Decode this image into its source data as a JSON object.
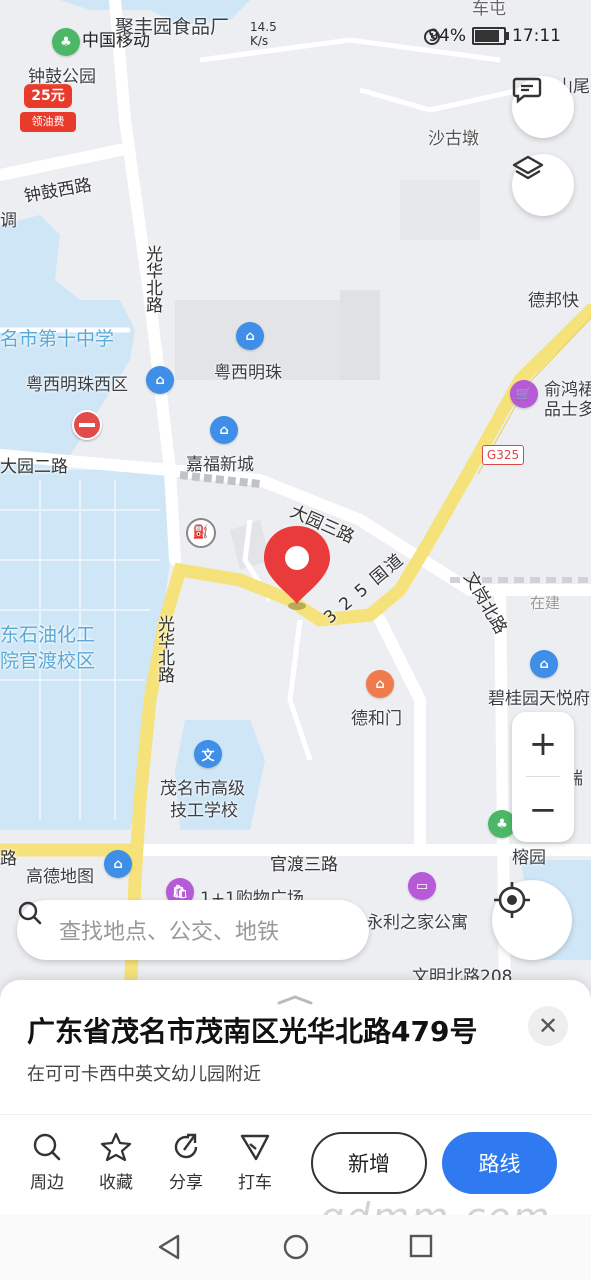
{
  "status_bar": {
    "carrier": "中国移动",
    "network_speed_value": "14.5",
    "network_speed_unit": "K/s",
    "battery_percent": "94%",
    "battery_level": 0.94,
    "time": "17:11"
  },
  "map": {
    "area_labels": {
      "food_factory": "聚丰园食品厂",
      "park": "钟鼓公园",
      "sha_gu_dun": "沙古墩",
      "zhonggu_west_road": "钟鼓西路",
      "school_10": "名市第十中学",
      "yuexi_pearl_west": "粤西明珠西区",
      "yuexi_pearl": "粤西明珠",
      "debang": "德邦快",
      "yuhong_1": "俞鸿裙",
      "yuhong_2": "品士多",
      "jiafu": "嘉福新城",
      "dayuan2": "大园二路",
      "dayuan3": "大园三路",
      "guanghua_n1": "光华北路",
      "guanghua_n2": "光华北路",
      "g325": "G325",
      "national_325": "3 2 5 国道",
      "wengang": "文岗北路",
      "under_construction": "在建",
      "petrochem_1": "东石油化工",
      "petrochem_2": "院官渡校区",
      "dehemen": "德和门",
      "biguiyuan": "碧桂园天悦府",
      "technician_1": "茂名市高级",
      "technician_2": "技工学校",
      "guandu3": "官渡三路",
      "rongyuan": "榕园",
      "amap": "高德地图",
      "mall": "1+1购物广场",
      "yonglizhijia": "永利之家公寓",
      "wenming": "文明北路208",
      "chewu": "车屯",
      "shanwei": "山尾",
      "diao": "调",
      "lu_left": "路",
      "rui": "瑞"
    },
    "oil_badge": {
      "amount": "25元",
      "label": "领油费"
    }
  },
  "search": {
    "placeholder": "查找地点、公交、地铁"
  },
  "sheet": {
    "title": "广东省茂名市茂南区光华北路479号",
    "subtitle": "在可可卡西中英文幼儿园附近",
    "actions": [
      {
        "label": "周边",
        "icon": "search-icon"
      },
      {
        "label": "收藏",
        "icon": "star-icon"
      },
      {
        "label": "分享",
        "icon": "share-icon"
      },
      {
        "label": "打车",
        "icon": "taxi-icon"
      }
    ],
    "add_label": "新增",
    "route_label": "路线"
  },
  "watermark": "gdmm.com",
  "colors": {
    "accent": "#2f7af0",
    "pin": "#e93b3b",
    "road_yellow": "#f6e27a",
    "water": "#cfe6f6"
  }
}
